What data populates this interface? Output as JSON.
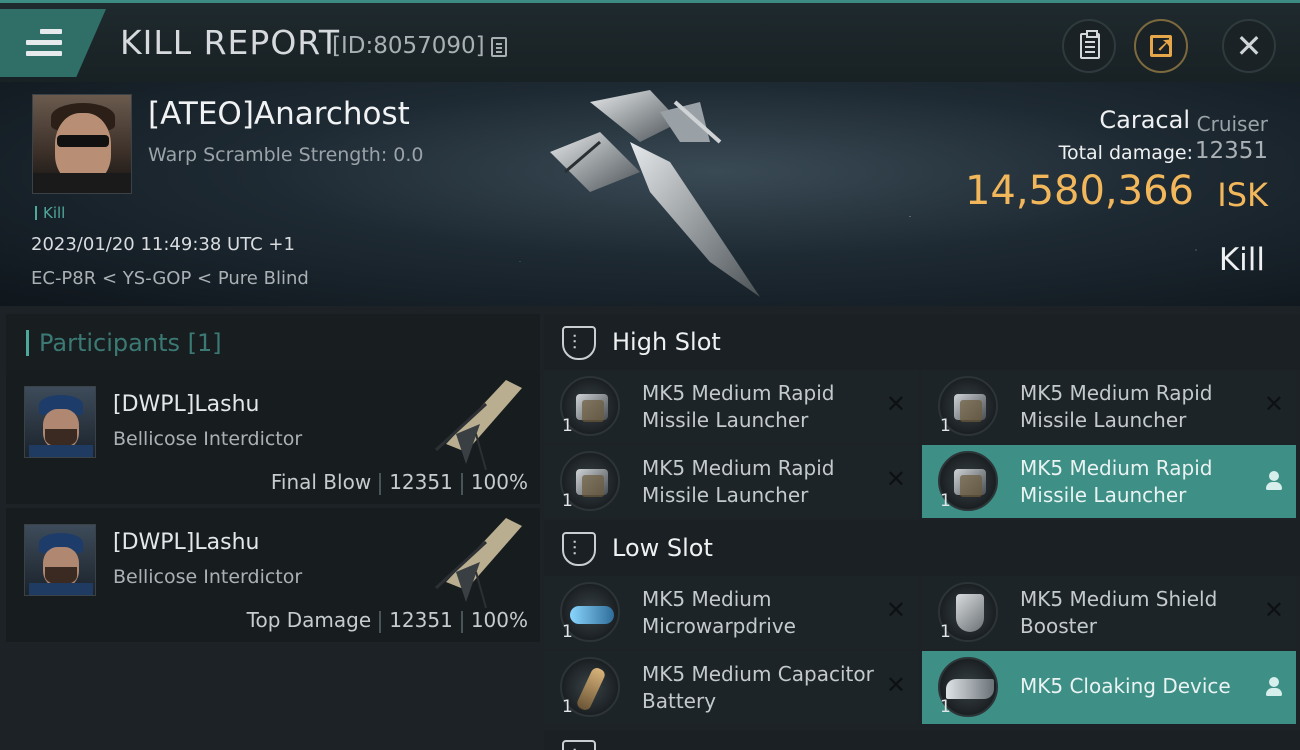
{
  "header": {
    "title": "KILL REPORT",
    "report_id": "[ID:8057090]"
  },
  "victim": {
    "name": "[ATEO]Anarchost",
    "warp_scramble": "Warp Scramble Strength: 0.0",
    "tag": "Kill",
    "datetime": "2023/01/20 11:49:38 UTC +1",
    "location": "EC-P8R < YS-GOP < Pure Blind",
    "ship_name": "Caracal",
    "ship_class": "Cruiser",
    "total_damage_label": "Total damage:",
    "total_damage": "12351",
    "isk_value": "14,580,366",
    "isk_unit": "ISK",
    "result": "Kill"
  },
  "participants": {
    "title": "Participants [1]",
    "cards": [
      {
        "name": "[DWPL]Lashu",
        "ship": "Bellicose Interdictor",
        "role": "Final Blow",
        "damage": "12351",
        "percent": "100%"
      },
      {
        "name": "[DWPL]Lashu",
        "ship": "Bellicose Interdictor",
        "role": "Top Damage",
        "damage": "12351",
        "percent": "100%"
      }
    ]
  },
  "slots": {
    "high": {
      "title": "High Slot",
      "modules": [
        {
          "name": "MK5 Medium Rapid Missile Launcher",
          "qty": "1",
          "state": "destroyed",
          "icon": "missile-launcher-icon"
        },
        {
          "name": "MK5 Medium Rapid Missile Launcher",
          "qty": "1",
          "state": "destroyed",
          "icon": "missile-launcher-icon"
        },
        {
          "name": "MK5 Medium Rapid Missile Launcher",
          "qty": "1",
          "state": "destroyed",
          "icon": "missile-launcher-icon"
        },
        {
          "name": "MK5 Medium Rapid Missile Launcher",
          "qty": "1",
          "state": "dropped",
          "icon": "missile-launcher-icon"
        }
      ]
    },
    "low": {
      "title": "Low Slot",
      "modules": [
        {
          "name": "MK5 Medium Microwarpdrive",
          "qty": "1",
          "state": "destroyed",
          "icon": "microwarpdrive-icon"
        },
        {
          "name": "MK5 Medium Shield Booster",
          "qty": "1",
          "state": "destroyed",
          "icon": "shield-booster-icon"
        },
        {
          "name": "MK5 Medium Capacitor Battery",
          "qty": "1",
          "state": "destroyed",
          "icon": "capacitor-battery-icon"
        },
        {
          "name": "MK5 Cloaking Device",
          "qty": "1",
          "state": "dropped",
          "icon": "cloaking-device-icon"
        }
      ]
    }
  },
  "colors": {
    "accent": "#3e8f86",
    "isk": "#f2b75b",
    "dropped_bg": "#3e8f86"
  }
}
